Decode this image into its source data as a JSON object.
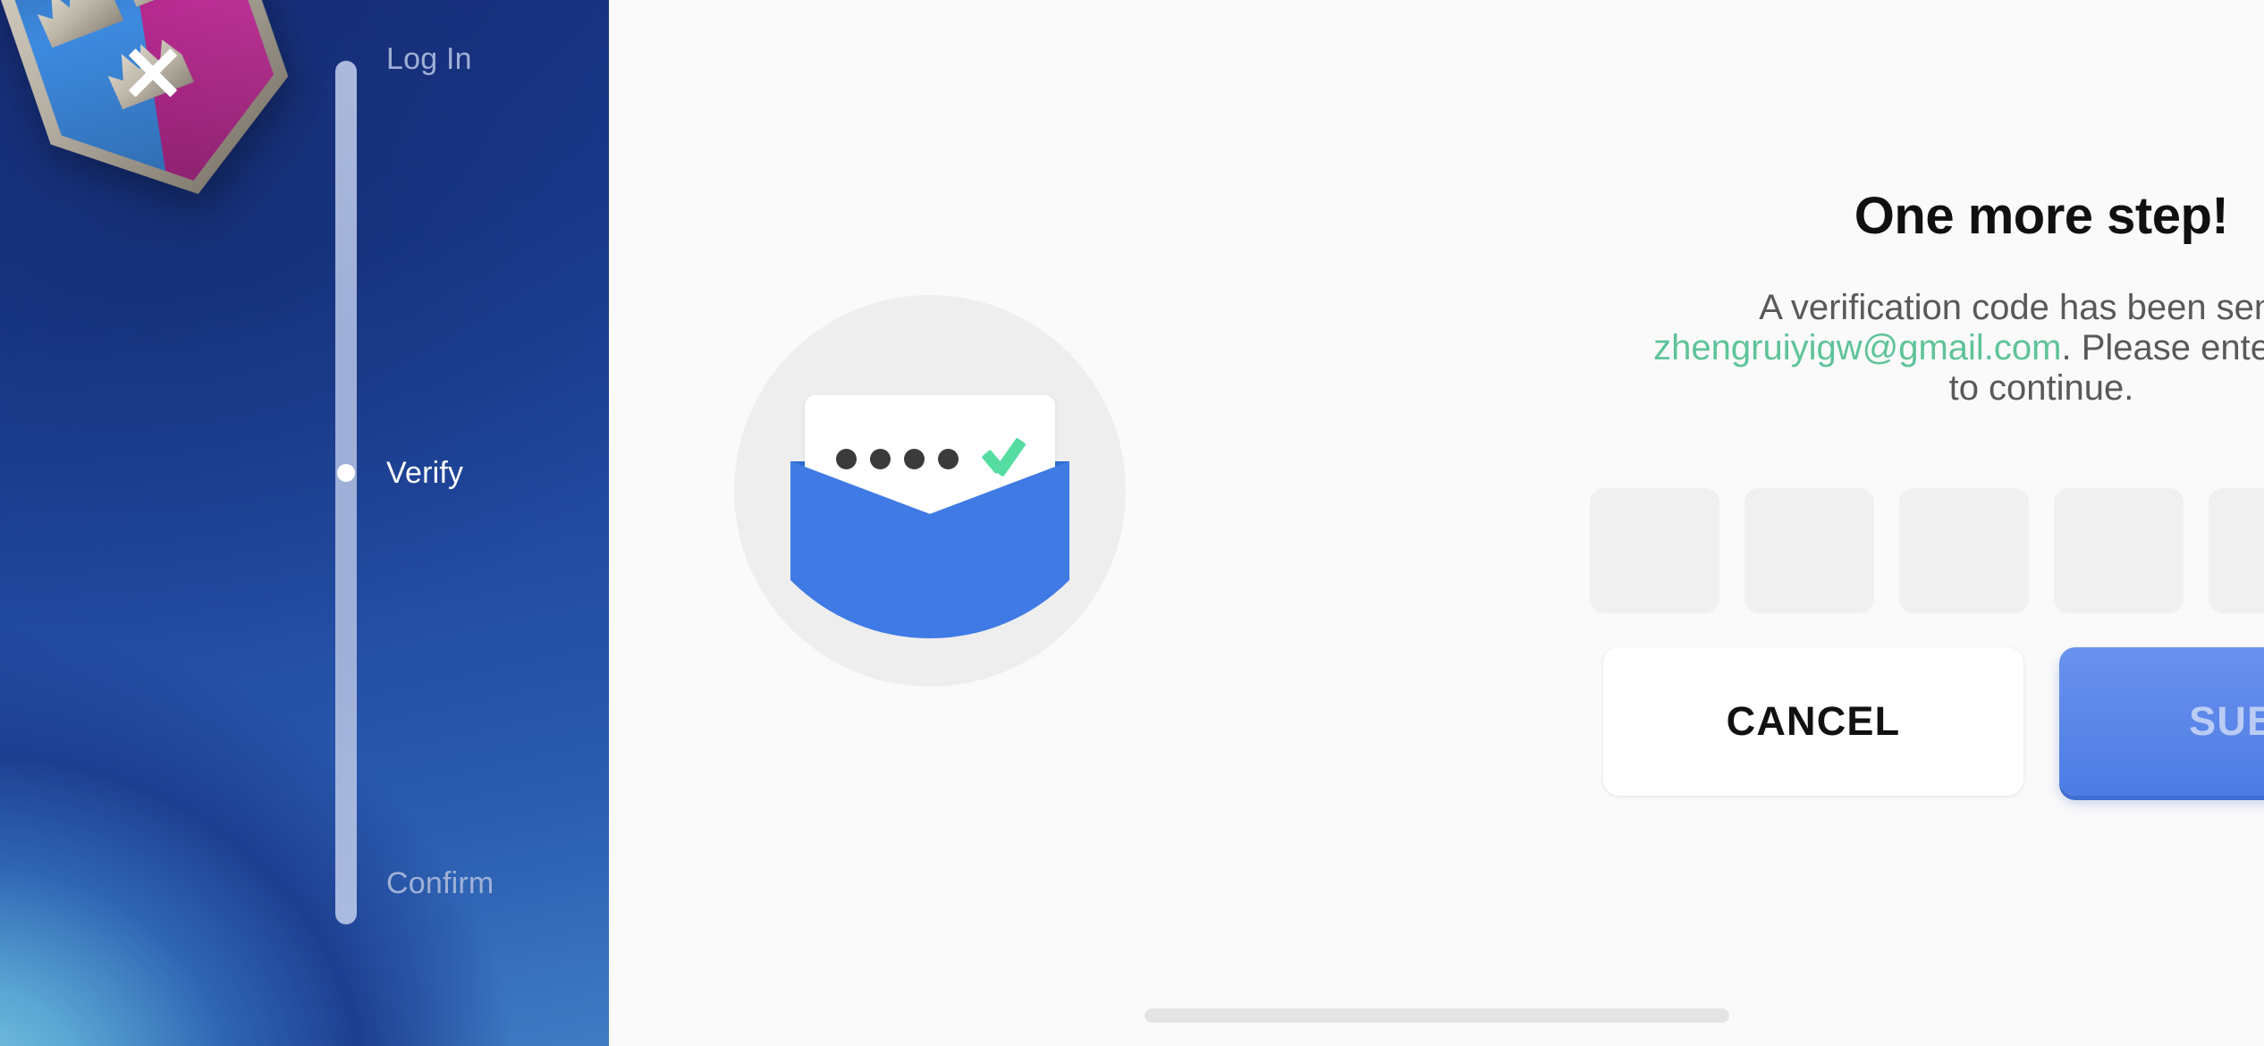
{
  "left": {
    "close_icon": "close-x-icon",
    "logo_icon": "game-shield-crest-icon",
    "stepper": {
      "steps": [
        {
          "label": "Log In",
          "state": "completed"
        },
        {
          "label": "Verify",
          "state": "active"
        },
        {
          "label": "Confirm",
          "state": "upcoming"
        }
      ],
      "active_index": 1,
      "track_color": "#aebce0",
      "active_dot_color": "#ffffff",
      "active_label_color": "#ffffff",
      "inactive_label_color": "#9fb0d6"
    },
    "background_colors": [
      "#18307f",
      "#214aa0",
      "#3f7cc4",
      "#7ec8e0"
    ]
  },
  "illustration": {
    "name": "email-verification-icon",
    "circle_color": "#eeeeee",
    "envelope_color": "#3f7ae5",
    "envelope_shadow_color": "#2f6fd0",
    "letter_color": "#ffffff",
    "dot_count": 4,
    "dot_color": "#3b3b3b",
    "check_color": "#55dda1"
  },
  "main": {
    "title": "One more step!",
    "subtitle_before": "A verification code has been sent to ",
    "email": "zhengruiyigw@gmail.com",
    "subtitle_after": ". Please enter the code to continue.",
    "email_color": "#5fc39a",
    "code_input": {
      "length": 6,
      "values": [
        "",
        "",
        "",
        "",
        "",
        ""
      ],
      "placeholder": "",
      "box_color": "#f0f0f0"
    },
    "buttons": {
      "cancel_label": "CANCEL",
      "submit_label": "SUBMIT",
      "submit_color": "#4d7ce4",
      "submit_disabled": true
    }
  },
  "system": {
    "home_indicator": "home-indicator-bar"
  }
}
